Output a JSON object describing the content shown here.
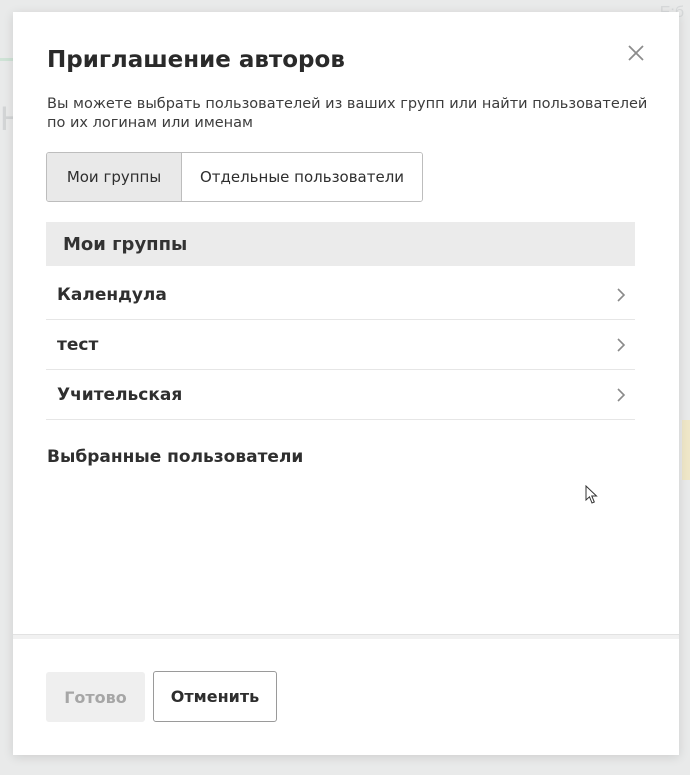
{
  "dialog": {
    "title": "Приглашение авторов",
    "description": "Вы можете выбрать пользователей из ваших групп или найти пользователей по их логинам или именам"
  },
  "tabs": [
    {
      "label": "Мои группы",
      "active": true
    },
    {
      "label": "Отдельные пользователи",
      "active": false
    }
  ],
  "groups": {
    "header": "Мои группы",
    "items": [
      {
        "label": "Календула"
      },
      {
        "label": "тест"
      },
      {
        "label": "Учительская"
      }
    ]
  },
  "selected_users": {
    "title": "Выбранные пользователи"
  },
  "footer": {
    "done_label": "Готово",
    "cancel_label": "Отменить"
  },
  "icons": {
    "close": "close-icon",
    "chevron": "chevron-right-icon",
    "cursor": "mouse-pointer-icon"
  },
  "colors": {
    "overlay": "#e9eaea",
    "panel": "#ffffff",
    "header_bg": "#ebebeb",
    "active_tab_bg": "#e9e9e9",
    "disabled_text": "#a6a6a6"
  }
}
